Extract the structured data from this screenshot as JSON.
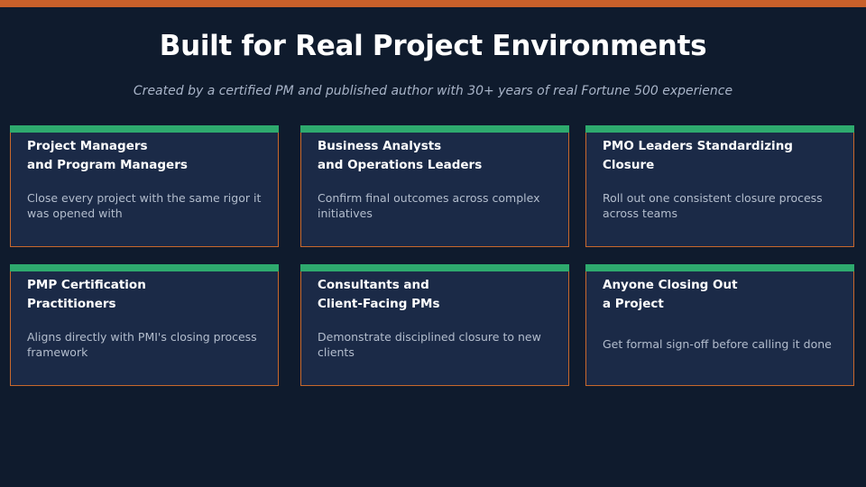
{
  "header": {
    "title": "Built for Real Project Environments",
    "subtitle": "Created by a certified PM and published author with 30+ years of real Fortune 500 experience"
  },
  "colors": {
    "background": "#0f1b2d",
    "top_bar": "#c8602a",
    "card_accent": "#2eaa6e",
    "card_border": "#c8682c",
    "card_background": "#1b2a47"
  },
  "cards": [
    {
      "title": "Project Managers\nand Program Managers",
      "description": "Close every project with the same rigor it was opened with"
    },
    {
      "title": "Business Analysts\nand Operations Leaders",
      "description": "Confirm final outcomes across complex initiatives"
    },
    {
      "title": "PMO Leaders Standardizing\nClosure",
      "description": "Roll out one consistent closure process across teams"
    },
    {
      "title": "PMP Certification\nPractitioners",
      "description": "Aligns directly with PMI's closing process framework"
    },
    {
      "title": "Consultants and\nClient-Facing PMs",
      "description": "Demonstrate disciplined closure to new clients"
    },
    {
      "title": "Anyone Closing Out\na Project",
      "description": "Get formal sign-off before calling it done"
    }
  ]
}
